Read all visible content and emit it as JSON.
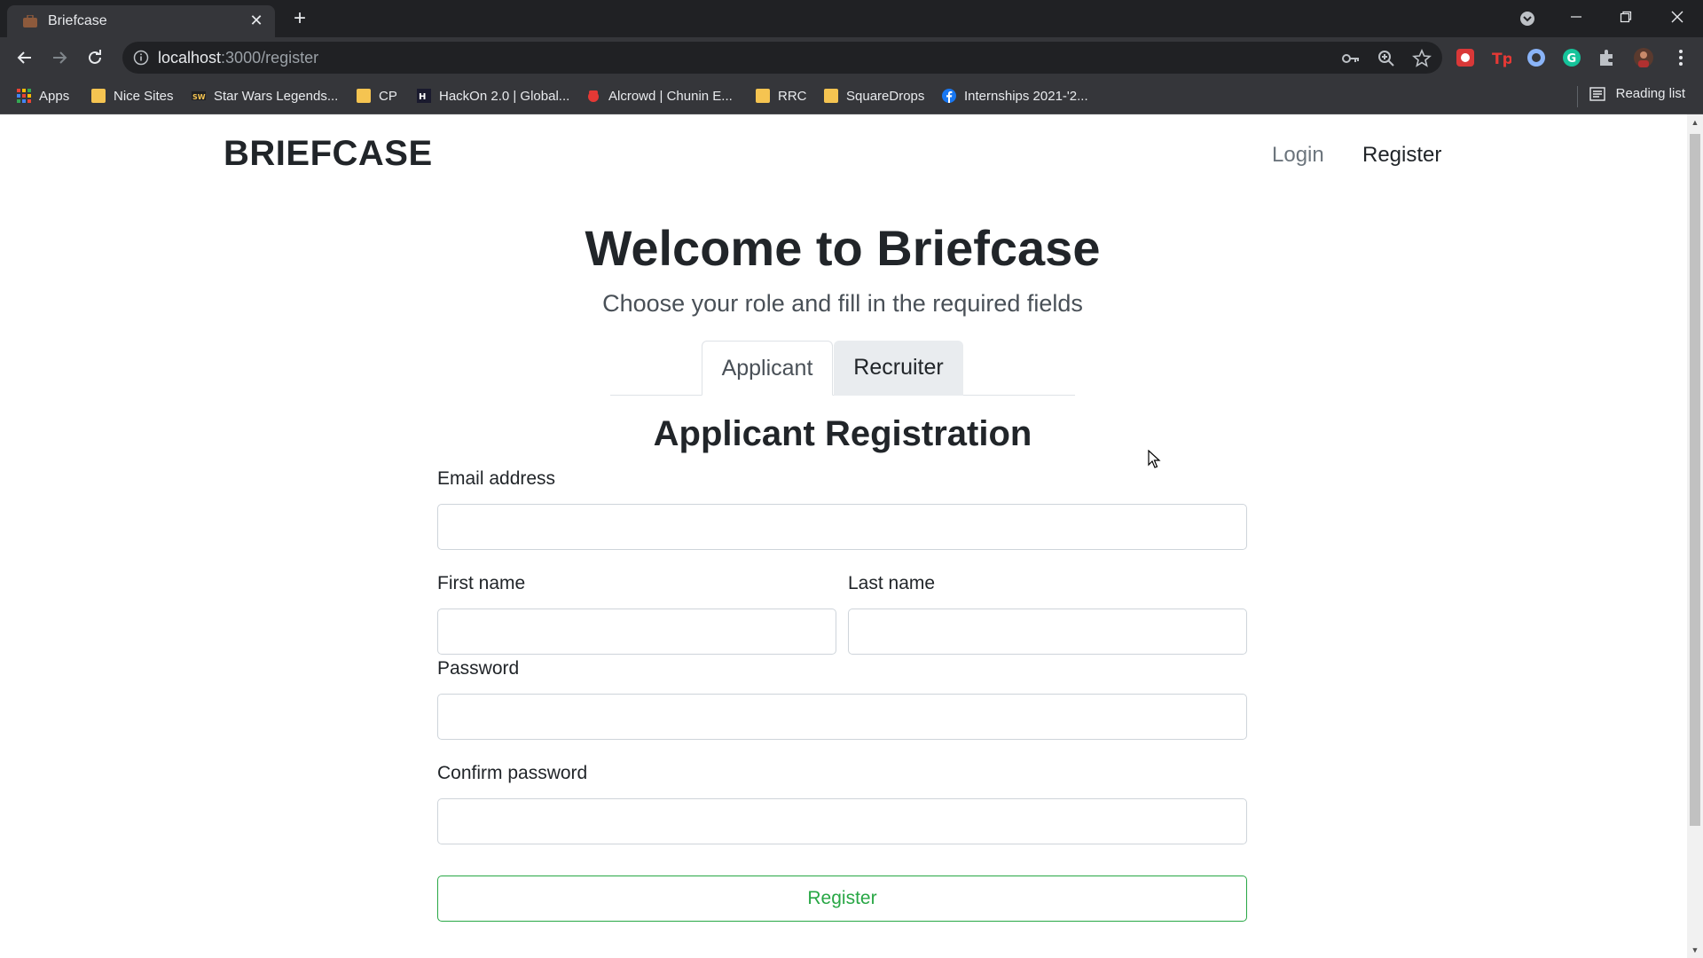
{
  "browser": {
    "tab_title": "Briefcase",
    "tab_close": "✕",
    "new_tab": "+",
    "url_host": "localhost",
    "url_path": ":3000/register",
    "bookmarks": [
      {
        "label": "Apps",
        "icon": "apps-grid-icon"
      },
      {
        "label": "Nice Sites",
        "icon": "folder-icon"
      },
      {
        "label": "Star Wars Legends...",
        "icon": "star-wars-icon"
      },
      {
        "label": "CP",
        "icon": "folder-icon"
      },
      {
        "label": "HackOn 2.0 | Global...",
        "icon": "hackon-icon"
      },
      {
        "label": "Alcrowd | Chunin E...",
        "icon": "aicrowd-icon"
      },
      {
        "label": "RRC",
        "icon": "folder-icon"
      },
      {
        "label": "SquareDrops",
        "icon": "folder-icon"
      },
      {
        "label": "Internships 2021-'2...",
        "icon": "facebook-icon"
      }
    ],
    "reading_list": "Reading list"
  },
  "page": {
    "brand": "BRIEFCASE",
    "nav": {
      "login": "Login",
      "register": "Register"
    },
    "hero_title": "Welcome to Briefcase",
    "hero_subtitle": "Choose your role and fill in the required fields",
    "role_tabs": {
      "active": "Applicant",
      "inactive": "Recruiter"
    },
    "form_title": "Applicant Registration",
    "fields": {
      "email": {
        "label": "Email address",
        "value": ""
      },
      "first_name": {
        "label": "First name",
        "value": ""
      },
      "last_name": {
        "label": "Last name",
        "value": ""
      },
      "password": {
        "label": "Password",
        "value": ""
      },
      "confirm_password": {
        "label": "Confirm password",
        "value": ""
      }
    },
    "submit_label": "Register"
  },
  "colors": {
    "success": "#28a745",
    "tab_inactive_bg": "#e9ecef",
    "chrome_dark": "#202124",
    "chrome_toolbar": "#35363a"
  }
}
